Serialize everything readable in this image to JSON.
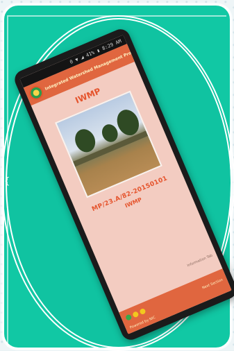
{
  "phone": {
    "status_text": "0 ▼ ◢ 41% ▮ 8:29 AM",
    "app_title": "Integrated Watershed Management Programme",
    "screen_title": "IWMP",
    "photo_caption_id": "MP/23.A/82-20150101",
    "photo_caption_program": "IWMP",
    "side_hint": "Information Tab",
    "footer_text": "Powered by NIC",
    "footer_right": "Next Section",
    "dot_colors": [
      "#3aa84b",
      "#f2c81e",
      "#f2c81e"
    ]
  },
  "colors": {
    "frame": "#11c8a4",
    "appbar": "#e0663f",
    "screen": "#f3ccc1",
    "accent_text": "#e5542d"
  }
}
